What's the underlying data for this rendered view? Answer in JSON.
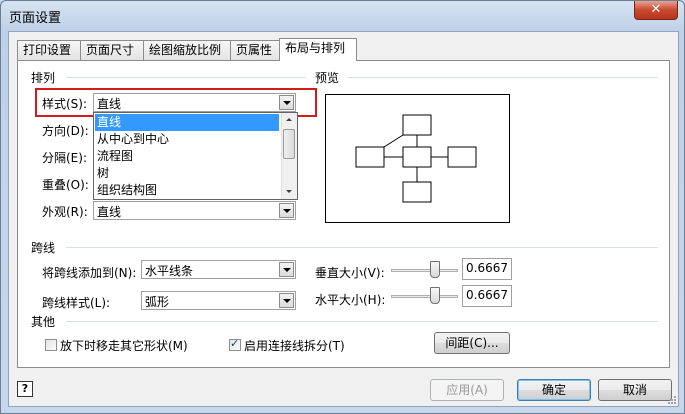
{
  "window": {
    "title": "页面设置",
    "close_glyph": "✕"
  },
  "tabs": [
    {
      "label": "打印设置",
      "active": false
    },
    {
      "label": "页面尺寸",
      "active": false
    },
    {
      "label": "绘图缩放比例",
      "active": false
    },
    {
      "label": "页属性",
      "active": false
    },
    {
      "label": "布局与排列",
      "active": true
    }
  ],
  "arrange": {
    "section_label": "排列",
    "style": {
      "label": "样式(S):",
      "value": "直线"
    },
    "direction": {
      "label": "方向(D):"
    },
    "separation": {
      "label": "分隔(E):"
    },
    "overlap": {
      "label": "重叠(O):"
    },
    "appearance": {
      "label": "外观(R):",
      "value": "直线"
    },
    "style_options": [
      "直线",
      "从中心到中心",
      "流程图",
      "树",
      "组织结构图"
    ],
    "selected_option": "直线"
  },
  "preview": {
    "section_label": "预览"
  },
  "jumps": {
    "section_label": "跨线",
    "add_to": {
      "label": "将跨线添加到(N):",
      "value": "水平线条"
    },
    "style": {
      "label": "跨线样式(L):",
      "value": "弧形"
    },
    "vertical_size": {
      "label": "垂直大小(V):",
      "value": "0.6667"
    },
    "horizontal_size": {
      "label": "水平大小(H):",
      "value": "0.6667"
    }
  },
  "other": {
    "section_label": "其他",
    "move_others": {
      "label": "放下时移走其它形状(M)",
      "checked": false
    },
    "enable_split": {
      "label": "启用连接线拆分(T)",
      "checked": true
    },
    "spacing_button": "间距(C)..."
  },
  "footer": {
    "help_glyph": "?",
    "apply": "应用(A)",
    "ok": "确定",
    "cancel": "取消"
  },
  "colors": {
    "highlight": "#d01c1c",
    "selection": "#3399ff"
  }
}
